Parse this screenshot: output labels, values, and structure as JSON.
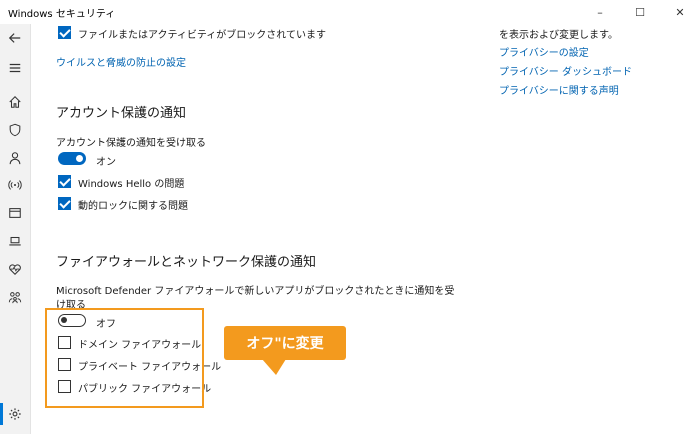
{
  "window": {
    "title": "Windows セキュリティ",
    "minimize": "–",
    "maximize": "☐",
    "close": "✕"
  },
  "sidebar": {
    "items": [
      {
        "name": "back-arrow-icon"
      },
      {
        "name": "menu-icon"
      },
      {
        "name": "home-icon"
      },
      {
        "name": "shield-icon"
      },
      {
        "name": "account-icon"
      },
      {
        "name": "wifi-icon"
      },
      {
        "name": "app-browser-icon"
      },
      {
        "name": "laptop-icon"
      },
      {
        "name": "heart-icon"
      },
      {
        "name": "family-icon"
      },
      {
        "name": "settings-icon"
      }
    ]
  },
  "main": {
    "blocked_files_label": "ファイルまたはアクティビティがブロックされています",
    "virus_link": "ウイルスと脅威の防止の設定",
    "account": {
      "heading": "アカウント保護の通知",
      "receive_label": "アカウント保護の通知を受け取る",
      "toggle_label": "オン",
      "item1": "Windows Hello の問題",
      "item2": "動的ロックに関する問題"
    },
    "firewall": {
      "heading": "ファイアウォールとネットワーク保護の通知",
      "desc_line1": "Microsoft Defender ファイアウォールで新しいアプリがブロックされたときに通知を受",
      "desc_line2": "け取る",
      "toggle_label": "オフ",
      "domain": "ドメイン ファイアウォール",
      "private": "プライベート ファイアウォール",
      "public": "パブリック ファイアウォール"
    }
  },
  "right": {
    "intro": "を表示および変更します。",
    "privacy_settings": "プライバシーの設定",
    "privacy_dashboard": "プライバシー ダッシュボード",
    "privacy_statement": "プライバシーに関する声明"
  },
  "callout": {
    "text": "オフ\"に変更"
  }
}
